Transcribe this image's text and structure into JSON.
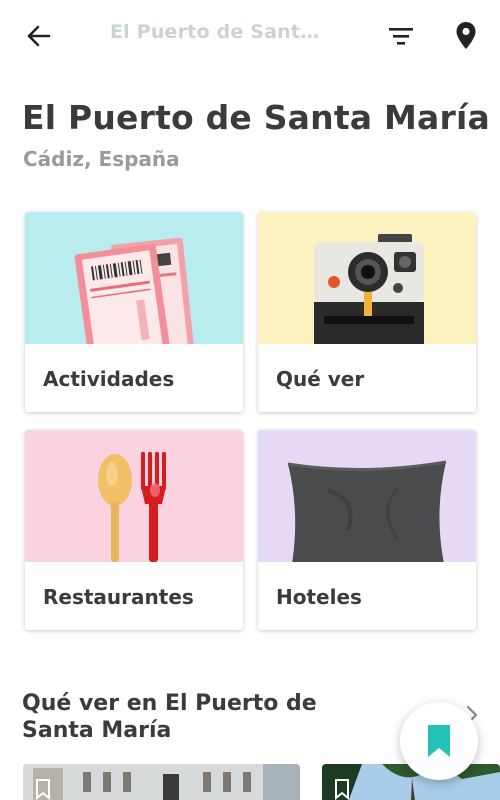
{
  "topbar": {
    "title": "El Puerto de Sant…",
    "icons": [
      "back-arrow-icon",
      "filter-icon",
      "location-pin-icon"
    ]
  },
  "header": {
    "title": "El Puerto de Santa María",
    "subtitle": "Cádiz, España"
  },
  "categories": [
    {
      "label": "Actividades",
      "image": "tickets",
      "bg": "#b9ecee"
    },
    {
      "label": "Qué ver",
      "image": "instant-camera",
      "bg": "#fcf2c0"
    },
    {
      "label": "Restaurantes",
      "image": "spoon-fork",
      "bg": "#fbd2df"
    },
    {
      "label": "Hoteles",
      "image": "pillow",
      "bg": "#e6d9f6"
    }
  ],
  "section": {
    "title": "Qué ver en El Puerto de Santa María"
  },
  "colors": {
    "accent": "#22c3b6",
    "title": "#3b3b3b",
    "muted": "#9a9a9a"
  }
}
